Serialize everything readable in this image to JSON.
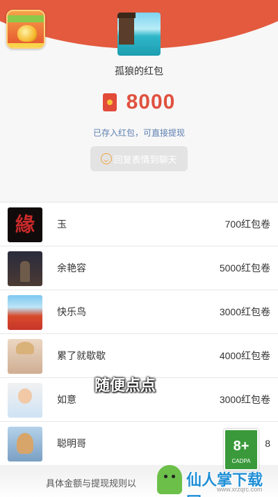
{
  "header": {
    "app_logo_icon": "red-packet-app-logo",
    "sender_name": "孤狼的红包",
    "packet_icon": "red-packet-icon",
    "amount": "8000",
    "stored_link": "已存入红包，可直接提现",
    "reply_button": "回复表情到聊天",
    "accent_color": "#e0513f"
  },
  "list": [
    {
      "name": "玉",
      "value": "700红包卷"
    },
    {
      "name": "余艳容",
      "value": "5000红包卷"
    },
    {
      "name": "快乐鸟",
      "value": "3000红包卷"
    },
    {
      "name": "累了就歇歇",
      "value": "4000红包卷"
    },
    {
      "name": "如意",
      "value": "3000红包卷"
    },
    {
      "name": "聪明哥",
      "value": "8"
    }
  ],
  "overlay": {
    "caption": "随便点点",
    "age_rating": "8+",
    "age_org": "CADPA",
    "footer_text": "具体金额与提现规则以",
    "watermark_text": "仙人掌下载网",
    "watermark_url": "www.xrzqrc.com"
  }
}
